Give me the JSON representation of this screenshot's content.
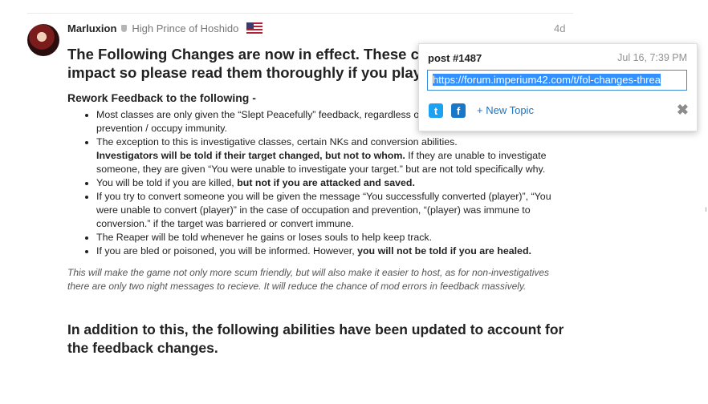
{
  "post": {
    "username": "Marluxion",
    "user_title": "High Prince of Hoshido",
    "date": "4d",
    "heading": "The Following Changes are now in effect. These changes have a major impact so please read them thoroughly if you play.",
    "section_heading": "Rework Feedback to the following -",
    "bullets": [
      "Most classes are only given the “Slept Peacefully” feedback, regardless of target changing / occupation / prevention / occupy immunity.",
      "The exception to this is investigative classes, certain NKs and conversion abilities.",
      "You will be told if you are killed, ",
      "If you try to convert someone you will be given the message “You successfully converted (player)”, “You were unable to convert (player)” in the case of occupation and prevention, “(player) was immune to conversion.” if the target was barriered or convert immune.",
      "The Reaper will be told whenever he gains or loses souls to help keep track.",
      "If you are bled or poisoned, you will be informed. However, "
    ],
    "bullet2_bold": "Investigators will be told if their target changed, but not to whom.",
    "bullet2_rest": " If they are unable to investigate someone, they are given “You were unable to investigate your target.” but are not told specifically why.",
    "bullet3_bold": "but not if you are attacked and saved.",
    "bullet6_bold": "you will not be told if you are healed.",
    "italic_note": "This will make the game not only more scum friendly, but will also make it easier to host, as for non-investigatives there are only two night messages to recieve. It will reduce the chance of mod errors in feedback massively.",
    "heading_2": "In addition to this, the following abilities have been updated to account for the feedback changes."
  },
  "share_popup": {
    "title": "post #1487",
    "date": "Jul 16, 7:39 PM",
    "url": "https://forum.imperium42.com/t/fol-changes-threa",
    "new_topic_label": "New Topic",
    "new_topic_plus": "+",
    "twitter_glyph": "t",
    "facebook_glyph": "f",
    "close_glyph": "✖"
  },
  "icons": {
    "shield": "shield-icon",
    "flag": "us-flag-icon",
    "twitter": "twitter-icon",
    "facebook": "facebook-icon",
    "close": "close-icon"
  },
  "colors": {
    "link": "#1b74c4",
    "twitter": "#1da1f2",
    "facebook": "#1877c9",
    "selection": "#3390ff"
  },
  "edge_mark": "ı"
}
